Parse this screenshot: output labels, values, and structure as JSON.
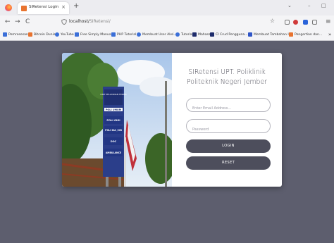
{
  "browser": {
    "tab_title": "SIRetensi Login",
    "tab_close": "×",
    "new_tab": "+",
    "url_host": "localhost/",
    "url_path": "SIRetensi/",
    "back": "←",
    "forward": "→",
    "reload": "C",
    "star": "☆",
    "win_chevron": "⌄",
    "win_minimize": "–",
    "win_restore": "□",
    "menu": "≡",
    "overflow": "»"
  },
  "bookmarks": [
    {
      "label": "Pemrosesan",
      "color": "#3b6fd8"
    },
    {
      "label": "Bitcoin Dunia",
      "color": "#e8732f"
    },
    {
      "label": "YouTube",
      "color": "#3b6fd8"
    },
    {
      "label": "Free Simply Manual",
      "color": "#3b6fd8"
    },
    {
      "label": "PHP Tutorial",
      "color": "#3b6fd8"
    },
    {
      "label": "Membuat User Aksi...",
      "color": "#3b6fd8"
    },
    {
      "label": "Tutorial",
      "color": "#3b6fd8"
    },
    {
      "label": "Mahasa",
      "color": "#1e2c6b"
    },
    {
      "label": "CI Crud Pengguna...",
      "color": "#1e2c6b"
    },
    {
      "label": "Membuat Tambahan ID",
      "color": "#2f55c7"
    },
    {
      "label": "Pengertian dan...",
      "color": "#e8732f"
    }
  ],
  "login": {
    "title_line1": "SIRetensi UPT. Poliklinik",
    "title_line2": "Politeknik Negeri Jember",
    "email_placeholder": "Enter Email Address...",
    "password_placeholder": "Password",
    "login_label": "LOGIN",
    "reset_label": "RESET"
  },
  "photo": {
    "sign_header": "UNIT PELAYANAN TEKNIS",
    "sign_lines": [
      "POLI UMUM",
      "POLI GIGI",
      "POLI KIA / KB",
      "DOC",
      "AMBULANCE"
    ]
  },
  "colors": {
    "page_bg": "#5d5e6e",
    "button_bg": "#4d4e5c",
    "accent_firefox": "#ff7139"
  }
}
